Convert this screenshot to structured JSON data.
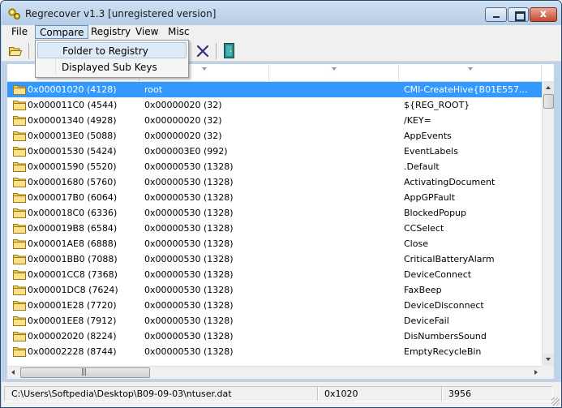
{
  "window": {
    "title": "Regrecover v1.3 [unregistered version]",
    "close_glyph": "x"
  },
  "menubar": {
    "items": [
      {
        "label": "File"
      },
      {
        "label": "Compare"
      },
      {
        "label": "Registry"
      },
      {
        "label": "View"
      },
      {
        "label": "Misc"
      }
    ],
    "open_menu": "Compare"
  },
  "compare_menu": {
    "items": [
      {
        "label": "Folder to Registry",
        "highlighted": true
      },
      {
        "label": "Displayed Sub Keys",
        "highlighted": false
      }
    ]
  },
  "toolbar": {
    "icons": [
      "open-folder-icon",
      "delete-icon",
      "exit-door-icon"
    ]
  },
  "list": {
    "selected_index": 0,
    "rows": [
      {
        "c1": "0x00001020 (4128)",
        "c2": "root",
        "c3": "CMI-CreateHive{B01E557..."
      },
      {
        "c1": "0x000011C0 (4544)",
        "c2": "0x00000020 (32)",
        "c3": "${REG_ROOT}"
      },
      {
        "c1": "0x00001340 (4928)",
        "c2": "0x00000020 (32)",
        "c3": "/KEY="
      },
      {
        "c1": "0x000013E0 (5088)",
        "c2": "0x00000020 (32)",
        "c3": "AppEvents"
      },
      {
        "c1": "0x00001530 (5424)",
        "c2": "0x000003E0 (992)",
        "c3": "EventLabels"
      },
      {
        "c1": "0x00001590 (5520)",
        "c2": "0x00000530 (1328)",
        "c3": ".Default"
      },
      {
        "c1": "0x00001680 (5760)",
        "c2": "0x00000530 (1328)",
        "c3": "ActivatingDocument"
      },
      {
        "c1": "0x000017B0 (6064)",
        "c2": "0x00000530 (1328)",
        "c3": "AppGPFault"
      },
      {
        "c1": "0x000018C0 (6336)",
        "c2": "0x00000530 (1328)",
        "c3": "BlockedPopup"
      },
      {
        "c1": "0x000019B8 (6584)",
        "c2": "0x00000530 (1328)",
        "c3": "CCSelect"
      },
      {
        "c1": "0x00001AE8 (6888)",
        "c2": "0x00000530 (1328)",
        "c3": "Close"
      },
      {
        "c1": "0x00001BB0 (7088)",
        "c2": "0x00000530 (1328)",
        "c3": "CriticalBatteryAlarm"
      },
      {
        "c1": "0x00001CC8 (7368)",
        "c2": "0x00000530 (1328)",
        "c3": "DeviceConnect"
      },
      {
        "c1": "0x00001DC8 (7624)",
        "c2": "0x00000530 (1328)",
        "c3": "FaxBeep"
      },
      {
        "c1": "0x00001E28 (7720)",
        "c2": "0x00000530 (1328)",
        "c3": "DeviceDisconnect"
      },
      {
        "c1": "0x00001EE8 (7912)",
        "c2": "0x00000530 (1328)",
        "c3": "DeviceFail"
      },
      {
        "c1": "0x00002020 (8224)",
        "c2": "0x00000530 (1328)",
        "c3": "DisNumbersSound"
      },
      {
        "c1": "0x00002228 (8744)",
        "c2": "0x00000530 (1328)",
        "c3": "EmptyRecycleBin"
      }
    ]
  },
  "scrollbar": {
    "hgrip": "|||"
  },
  "statusbar": {
    "path": "C:\\Users\\Softpedia\\Desktop\\B09-09-03\\ntuser.dat",
    "offset": "0x1020",
    "count": "3956"
  },
  "colors": {
    "selection": "#3399ff",
    "chrome": "#f0f0f0",
    "titlebar": "#bcd3ea",
    "close_button": "#c5472c"
  }
}
